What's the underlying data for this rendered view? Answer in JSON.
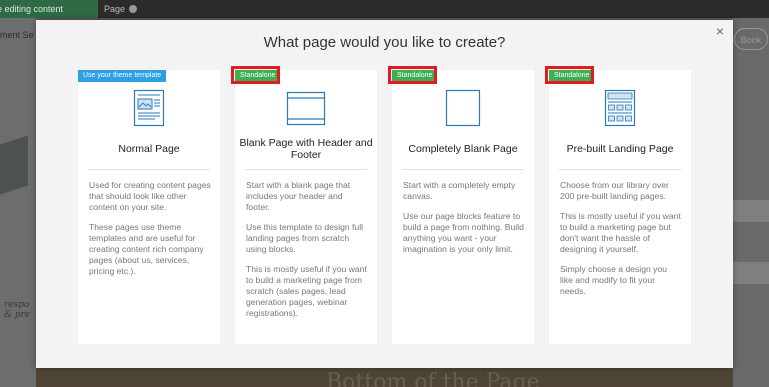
{
  "background": {
    "editing_tab": "re editing content",
    "page_tab": "Page",
    "left_label": "ment Se",
    "left_script": "respo\n& pre",
    "right_button": "Book",
    "bottom_text": "Bottom of the Page"
  },
  "modal": {
    "title": "What page would you like to create?",
    "close_icon": "×",
    "cards": [
      {
        "badge": "Use your theme template",
        "icon": "normal-page-icon",
        "title": "Normal Page",
        "description": [
          "Used for creating content pages that should look like other content on your site.",
          "These pages use theme templates and are useful for creating content rich company pages (about us, services, pricing etc.)."
        ]
      },
      {
        "badge": "Standalone",
        "icon": "header-footer-page-icon",
        "title": "Blank Page with Header and Footer",
        "description": [
          "Start with a blank page that includes your header and footer.",
          "Use this template to design full landing pages from scratch using blocks.",
          "This is mostly useful if you want to build a marketing page from scratch (sales pages, lead generation pages, webinar registrations)."
        ]
      },
      {
        "badge": "Standalone",
        "icon": "blank-page-icon",
        "title": "Completely Blank Page",
        "description": [
          "Start with a completely empty canvas.",
          "Use our page blocks feature to build a page from nothing. Build anything you want - your imagination is your only limit."
        ]
      },
      {
        "badge": "Standalone",
        "icon": "landing-page-icon",
        "title": "Pre-built Landing Page",
        "description": [
          "Choose from our library over 200 pre-built landing pages.",
          "This is mostly useful if you want to build a marketing page but don't want the hassle of designing it yourself.",
          "Simply choose a design you like and modify to fit your needs."
        ]
      }
    ]
  },
  "colors": {
    "theme_badge": "#2c9fe6",
    "standalone_badge": "#3fae52",
    "highlight": "#e01b24",
    "icon_blue": "#2a7ab8"
  }
}
